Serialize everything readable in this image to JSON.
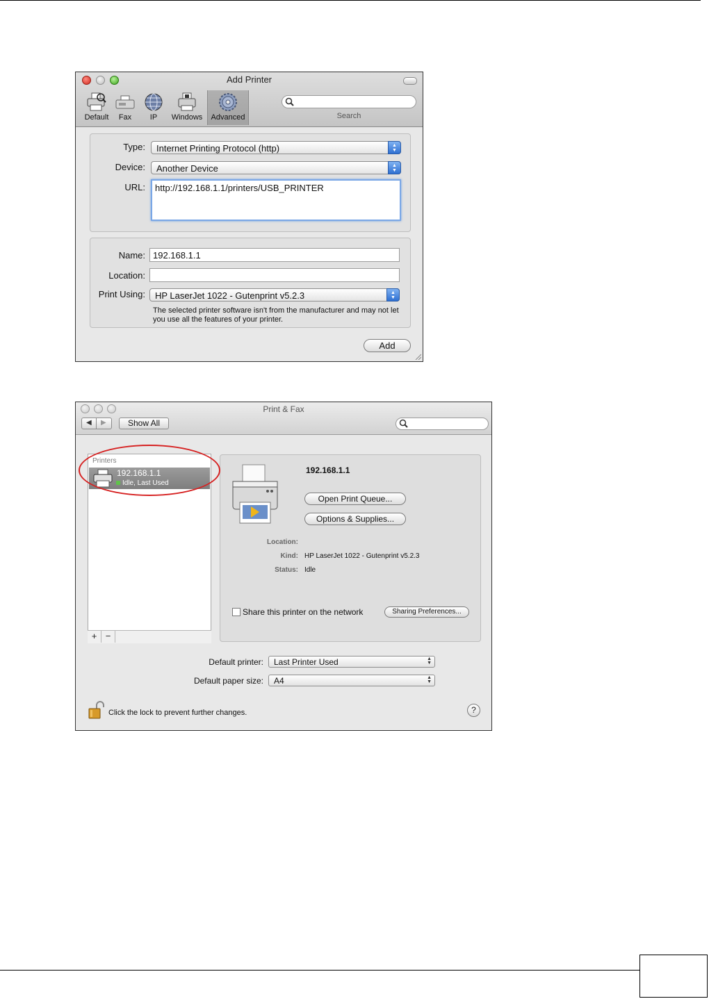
{
  "add_printer": {
    "title": "Add Printer",
    "toolbar": [
      {
        "label": "Default",
        "icon": "default-printer-icon"
      },
      {
        "label": "Fax",
        "icon": "fax-icon"
      },
      {
        "label": "IP",
        "icon": "globe-icon"
      },
      {
        "label": "Windows",
        "icon": "windows-printer-icon"
      },
      {
        "label": "Advanced",
        "icon": "gear-icon",
        "active": true
      }
    ],
    "search": {
      "label": "Search",
      "value": ""
    },
    "type": {
      "label": "Type:",
      "value": "Internet Printing Protocol (http)"
    },
    "device": {
      "label": "Device:",
      "value": "Another Device"
    },
    "url": {
      "label": "URL:",
      "value": "http://192.168.1.1/printers/USB_PRINTER"
    },
    "name": {
      "label": "Name:",
      "value": "192.168.1.1"
    },
    "location": {
      "label": "Location:",
      "value": ""
    },
    "print_using": {
      "label": "Print Using:",
      "value": "HP LaserJet 1022 - Gutenprint v5.2.3"
    },
    "note": "The selected printer software isn't from the manufacturer and may not let you use all the features of your printer.",
    "add_button": "Add"
  },
  "print_fax": {
    "title": "Print & Fax",
    "show_all": "Show All",
    "nav_back": "◀",
    "nav_forward": "▶",
    "printers_header": "Printers",
    "printer": {
      "name": "192.168.1.1",
      "status": "Idle, Last Used"
    },
    "add_symbol": "+",
    "remove_symbol": "−",
    "detail": {
      "name": "192.168.1.1",
      "open_queue": "Open Print Queue...",
      "options": "Options & Supplies...",
      "location_label": "Location:",
      "location_value": "",
      "kind_label": "Kind:",
      "kind_value": "HP LaserJet 1022 - Gutenprint v5.2.3",
      "status_label": "Status:",
      "status_value": "Idle",
      "share_label": "Share this printer on the network",
      "share_checked": false,
      "sharing_prefs": "Sharing Preferences..."
    },
    "default_printer": {
      "label": "Default printer:",
      "value": "Last Printer Used"
    },
    "default_paper": {
      "label": "Default paper size:",
      "value": "A4"
    },
    "lock_text": "Click the lock to prevent further changes.",
    "help": "?"
  },
  "colors": {
    "highlight": "#d62020",
    "focus": "#7aa7e6",
    "selected_row": "#8a8a8a"
  }
}
